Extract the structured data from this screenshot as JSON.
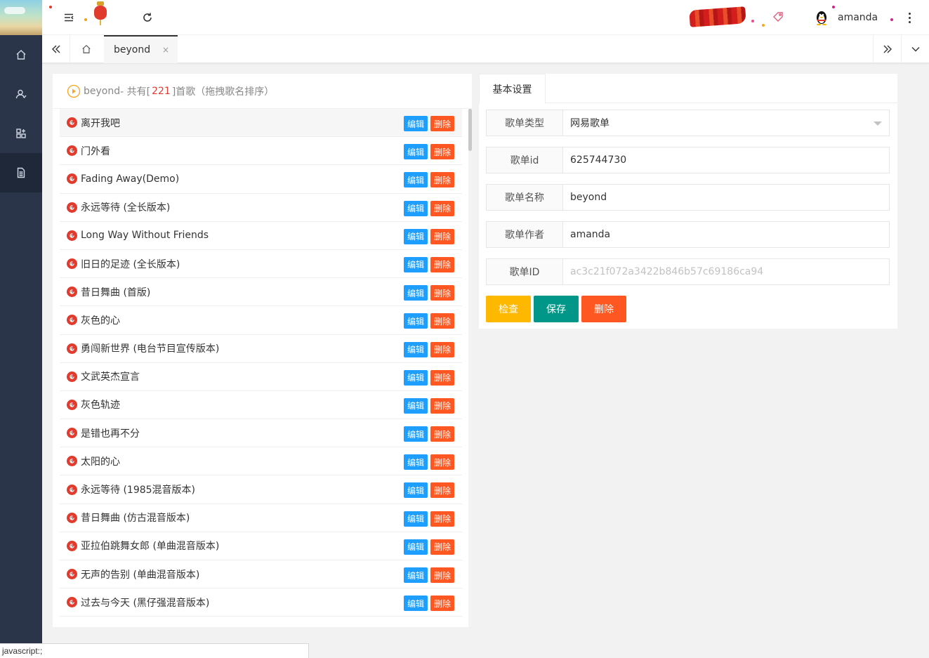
{
  "header": {
    "username": "amanda"
  },
  "tabs": {
    "active_label": "beyond",
    "close_glyph": "×"
  },
  "playlist": {
    "name": "beyond",
    "prefix": " - 共有[ ",
    "count": "221",
    "suffix": " ]首歌（拖拽歌名排序）",
    "edit_label": "编辑",
    "delete_label": "删除",
    "songs": [
      "离开我吧",
      "门外看",
      "Fading Away(Demo)",
      "永远等待 (全长版本)",
      "Long Way Without Friends",
      "旧日的足迹 (全长版本)",
      "昔日舞曲 (首版)",
      "灰色的心",
      "勇闯新世界 (电台节目宣传版本)",
      "文武英杰宣言",
      "灰色轨迹",
      "是错也再不分",
      "太阳的心",
      "永远等待 (1985混音版本)",
      "昔日舞曲 (仿古混音版本)",
      "亚拉伯跳舞女郎 (单曲混音版本)",
      "无声的告别 (单曲混音版本)",
      "过去与今天 (黑仔强混音版本)"
    ]
  },
  "settings": {
    "tab_label": "基本设置",
    "fields": {
      "type": {
        "label": "歌单类型",
        "value": "网易歌单"
      },
      "id": {
        "label": "歌单id",
        "value": "625744730"
      },
      "name": {
        "label": "歌单名称",
        "value": "beyond"
      },
      "author": {
        "label": "歌单作者",
        "value": "amanda"
      },
      "uid": {
        "label": "歌单ID",
        "placeholder": "ac3c21f072a3422b846b57c69186ca94"
      }
    },
    "buttons": {
      "check": "检查",
      "save": "保存",
      "delete": "删除"
    }
  },
  "status_bar": {
    "text": "javascript:;"
  },
  "colors": {
    "sidebar": "#2b3549",
    "edit_button": "#1e9fff",
    "delete_button": "#ff5722",
    "check_button": "#ffb800",
    "save_button": "#009688",
    "netease_red": "#e03b2c"
  }
}
